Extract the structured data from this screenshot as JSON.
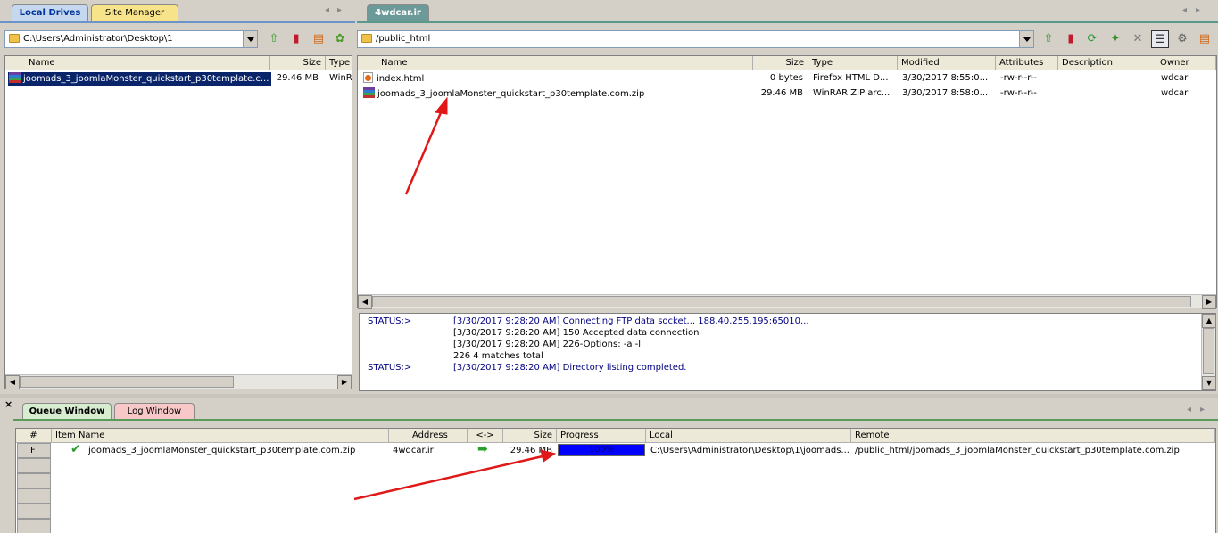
{
  "left_tabs": [
    {
      "label": "Local Drives"
    },
    {
      "label": "Site Manager"
    }
  ],
  "right_tab": {
    "label": "4wdcar.ir"
  },
  "tab_nav": {
    "prev": "◂",
    "next": "▸"
  },
  "local": {
    "path": "C:\\Users\\Administrator\\Desktop\\1",
    "columns": [
      "Name",
      "Size",
      "Type"
    ],
    "files": [
      {
        "name": "joomads_3_joomlaMonster_quickstart_p30template.c...",
        "size": "29.46 MB",
        "type": "WinR"
      }
    ]
  },
  "remote": {
    "path": "/public_html",
    "columns": [
      "Name",
      "Size",
      "Type",
      "Modified",
      "Attributes",
      "Description",
      "Owner"
    ],
    "files": [
      {
        "name": "index.html",
        "size": "0 bytes",
        "type": "Firefox HTML D...",
        "modified": "3/30/2017 8:55:0...",
        "attributes": "-rw-r--r--",
        "description": "",
        "owner": "wdcar"
      },
      {
        "name": "joomads_3_joomlaMonster_quickstart_p30template.com.zip",
        "size": "29.46 MB",
        "type": "WinRAR ZIP arc...",
        "modified": "3/30/2017 8:58:0...",
        "attributes": "-rw-r--r--",
        "description": "",
        "owner": "wdcar"
      }
    ]
  },
  "log": [
    {
      "prefix": "STATUS:>",
      "text": "[3/30/2017 9:28:20 AM] Connecting FTP data socket... 188.40.255.195:65010..."
    },
    {
      "prefix": "",
      "text": "[3/30/2017 9:28:20 AM] 150 Accepted data connection"
    },
    {
      "prefix": "",
      "text": "[3/30/2017 9:28:20 AM] 226-Options: -a -l"
    },
    {
      "prefix": "",
      "text": "226 4 matches total"
    },
    {
      "prefix": "STATUS:>",
      "text": "[3/30/2017 9:28:20 AM] Directory listing completed."
    }
  ],
  "bottom_tabs": [
    {
      "label": "Queue Window"
    },
    {
      "label": "Log Window"
    }
  ],
  "close_glyph": "×",
  "queue": {
    "columns": [
      "#",
      "Item Name",
      "Address",
      "<->",
      "Size",
      "Progress",
      "Local",
      "Remote"
    ],
    "items": [
      {
        "num": "F",
        "name": "joomads_3_joomlaMonster_quickstart_p30template.com.zip",
        "address": "4wdcar.ir",
        "size": "29.46 MB",
        "progress": 100,
        "progress_label": "100%",
        "local": "C:\\Users\\Administrator\\Desktop\\1\\joomads...",
        "remote": "/public_html/joomads_3_joomlaMonster_quickstart_p30template.com.zip"
      }
    ]
  },
  "colors": {
    "progress": "#0000ff",
    "annotation_arrow": "#e01818",
    "log_text": "#000080",
    "selection": "#0a246a"
  }
}
